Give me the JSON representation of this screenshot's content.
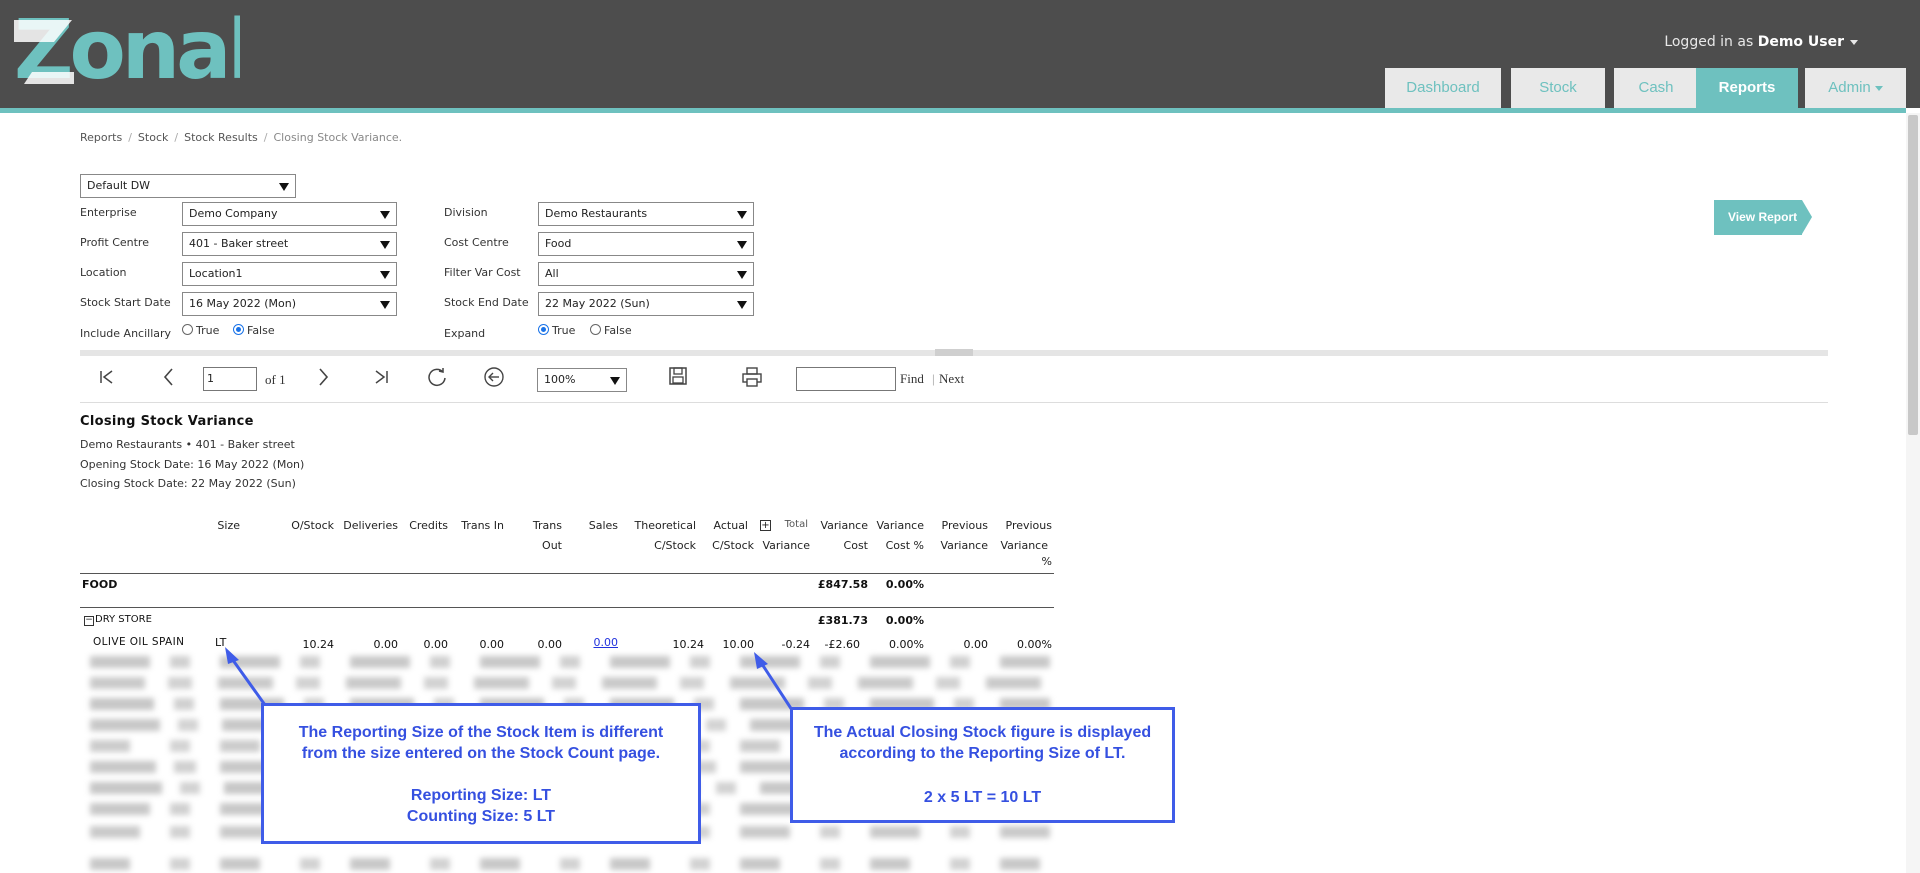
{
  "header": {
    "logo_text": "Zonal",
    "logged_prefix": "Logged in as",
    "user_name": "Demo User",
    "nav": [
      {
        "label": "Dashboard"
      },
      {
        "label": "Stock"
      },
      {
        "label": "Cash"
      },
      {
        "label": "Reports",
        "active": true
      },
      {
        "label": "Admin"
      }
    ]
  },
  "breadcrumb": [
    "Reports",
    "Stock",
    "Stock Results",
    "Closing Stock Variance."
  ],
  "form": {
    "profile": "Default DW",
    "enterprise_label": "Enterprise",
    "enterprise": "Demo Company",
    "profit_centre_label": "Profit Centre",
    "profit_centre": "401 - Baker street",
    "location_label": "Location",
    "location": "Location1",
    "stock_start_label": "Stock Start Date",
    "stock_start": "16 May 2022 (Mon)",
    "include_ancillary_label": "Include Ancillary",
    "division_label": "Division",
    "division": "Demo Restaurants",
    "cost_centre_label": "Cost Centre",
    "cost_centre": "Food",
    "filter_var_cost_label": "Filter Var Cost",
    "filter_var_cost": "All",
    "stock_end_label": "Stock End Date",
    "stock_end": "22 May 2022 (Sun)",
    "expand_label": "Expand",
    "true_label": "True",
    "false_label": "False",
    "include_ancillary_value": "False",
    "expand_value": "True",
    "view_report": "View Report"
  },
  "toolbar": {
    "page": "1",
    "of_label": "of 1",
    "zoom": "100%",
    "find_label": "Find",
    "sep": "|",
    "next_label": "Next"
  },
  "report": {
    "title": "Closing Stock Variance",
    "subtitle": "Demo Restaurants •  401 - Baker street",
    "opening": "Opening Stock Date: 16 May 2022 (Mon)",
    "closing": "Closing Stock Date: 22 May 2022 (Sun)",
    "headers": {
      "size": "Size",
      "ostock": "O/Stock",
      "deliveries": "Deliveries",
      "credits": "Credits",
      "trans_in": "Trans In",
      "trans_out_1": "Trans",
      "trans_out_2": "Out",
      "sales": "Sales",
      "theo_1": "Theoretical",
      "theo_2": "C/Stock",
      "actual_1": "Actual",
      "actual_2": "C/Stock",
      "total_1": "Total",
      "total_2": "Variance",
      "var_cost_1": "Variance",
      "var_cost_2": "Cost",
      "var_pct_1": "Variance",
      "var_pct_2": "Cost %",
      "prev_var_1": "Previous",
      "prev_var_2": "Variance",
      "prev_pct_1": "Previous",
      "prev_pct_2": "Variance",
      "prev_pct_3": "%"
    },
    "food": {
      "label": "FOOD",
      "var_cost": "£847.58",
      "var_pct": "0.00%"
    },
    "dry_store": {
      "label": "DRY STORE",
      "var_cost": "£381.73",
      "var_pct": "0.00%"
    },
    "item": {
      "name": "OLIVE OIL SPAIN",
      "size": "LT",
      "ostock": "10.24",
      "deliveries": "0.00",
      "credits": "0.00",
      "trans_in": "0.00",
      "trans_out": "0.00",
      "sales": "0.00",
      "theo": "10.24",
      "actual": "10.00",
      "total_var": "-0.24",
      "var_cost": "-£2.60",
      "var_pct": "0.00%",
      "prev_var": "0.00",
      "prev_pct": "0.00%"
    }
  },
  "callouts": {
    "left": {
      "line1": "The Reporting Size of the Stock Item is different",
      "line2": "from the size entered on the Stock Count page.",
      "line3": "Reporting Size: LT",
      "line4": "Counting Size: 5 LT"
    },
    "right": {
      "line1": "The Actual Closing Stock figure is displayed",
      "line2": "according to the Reporting Size of LT.",
      "line3": "2 x 5 LT = 10 LT"
    }
  },
  "colors": {
    "header_bg": "#4d4d4d",
    "accent": "#6ec1bf",
    "callout": "#3f5ce8"
  }
}
